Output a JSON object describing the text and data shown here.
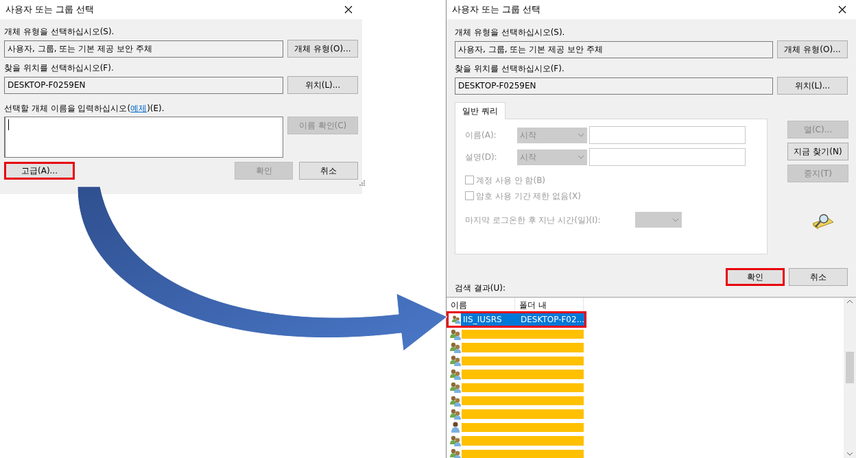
{
  "left_dialog": {
    "title": "사용자 또는 그룹 선택",
    "object_type_label": "개체 유형을 선택하십시오(S).",
    "object_type_value": "사용자, 그룹, 또는 기본 제공 보안 주체",
    "object_type_button": {
      "label": "개체 유형(O)...",
      "disabled": false,
      "highlighted": false
    },
    "location_label": "찾을 위치를 선택하십시오(F).",
    "location_value": "DESKTOP-F0259EN",
    "location_button": {
      "label": "위치(L)...",
      "disabled": false,
      "highlighted": false
    },
    "names_label": {
      "before": "선택할 개체 이름을 입력하십시오(",
      "link": "예제",
      "after": ")(E)."
    },
    "check_names_button": {
      "label": "이름 확인(C)",
      "disabled": true,
      "highlighted": false
    },
    "advanced_button": {
      "label": "고급(A)...",
      "disabled": false,
      "highlighted": true
    },
    "ok_button": {
      "label": "확인",
      "disabled": true,
      "highlighted": false
    },
    "cancel_button": {
      "label": "취소",
      "disabled": false,
      "highlighted": false
    }
  },
  "right_dialog": {
    "title": "사용자 또는 그룹 선택",
    "object_type_label": "개체 유형을 선택하십시오(S).",
    "object_type_value": "사용자, 그룹, 또는 기본 제공 보안 주체",
    "object_type_button": {
      "label": "개체 유형(O)...",
      "disabled": false,
      "highlighted": false
    },
    "location_label": "찾을 위치를 선택하십시오(F).",
    "location_value": "DESKTOP-F0259EN",
    "location_button": {
      "label": "위치(L)...",
      "disabled": false,
      "highlighted": false
    },
    "tabs": [
      {
        "label": "일반 쿼리",
        "selected": true
      }
    ],
    "query": {
      "disabled": true,
      "fields": [
        {
          "label": "이름(A):",
          "operator": "시작"
        },
        {
          "label": "설명(D):",
          "operator": "시작"
        }
      ],
      "checkboxes": [
        {
          "label": "계정 사용 안 함(B)",
          "checked": false
        },
        {
          "label": "암호 사용 기간 제한 없음(X)",
          "checked": false
        }
      ],
      "days_label": "마지막 로그온한 후 지난 시간(일)(I):"
    },
    "side_buttons": [
      {
        "label": "열(C)...",
        "disabled": true,
        "highlighted": false
      },
      {
        "label": "지금 찾기(N)",
        "disabled": false,
        "highlighted": false
      },
      {
        "label": "중지(T)",
        "disabled": true,
        "highlighted": false
      }
    ],
    "ok_button": {
      "label": "확인",
      "disabled": false,
      "highlighted": true
    },
    "cancel_button": {
      "label": "취소",
      "disabled": false,
      "highlighted": false
    },
    "results_label": "검색 결과(U):",
    "columns": [
      "이름",
      "폴더 내"
    ],
    "rows": [
      {
        "kind": "group",
        "name": "IIS_IUSRS",
        "folder": "DESKTOP-F02...",
        "selected": true,
        "highlighted": true
      },
      {
        "kind": "group",
        "selected": false,
        "highlighted": false
      },
      {
        "kind": "group",
        "selected": false,
        "highlighted": false
      },
      {
        "kind": "group",
        "selected": false,
        "highlighted": false
      },
      {
        "kind": "group",
        "selected": false,
        "highlighted": false
      },
      {
        "kind": "group",
        "selected": false,
        "highlighted": false
      },
      {
        "kind": "group",
        "selected": false,
        "highlighted": false
      },
      {
        "kind": "group",
        "selected": false,
        "highlighted": false
      },
      {
        "kind": "user",
        "selected": false,
        "highlighted": false
      },
      {
        "kind": "group",
        "selected": false,
        "highlighted": false
      },
      {
        "kind": "group",
        "selected": false,
        "highlighted": false
      }
    ]
  }
}
